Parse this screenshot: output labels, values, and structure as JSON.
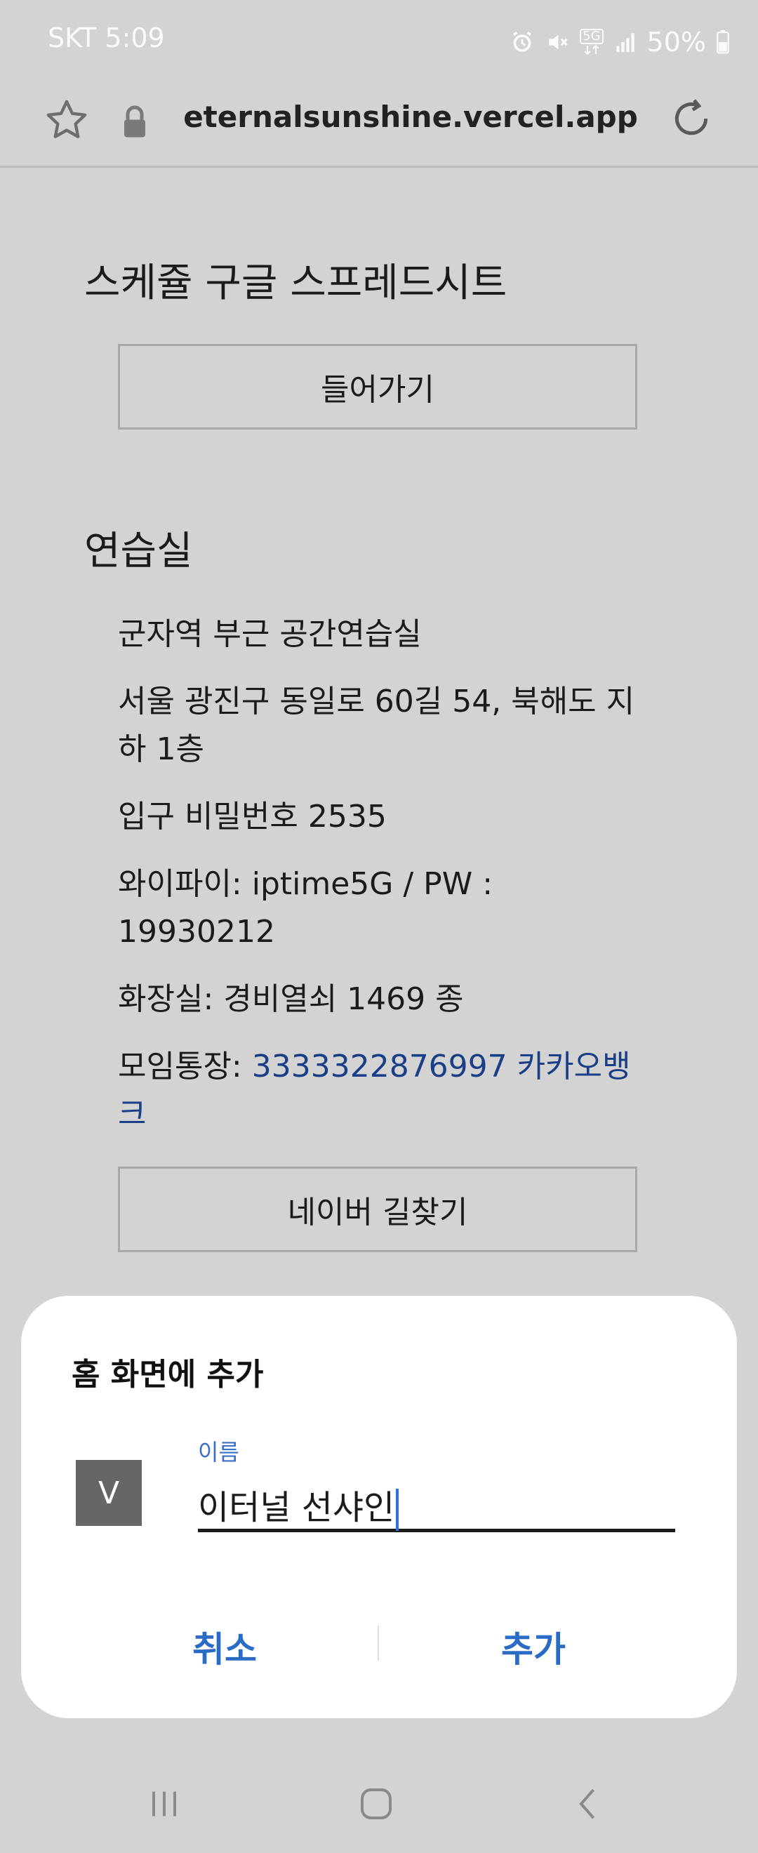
{
  "status_bar": {
    "carrier_time": "SKT 5:09",
    "network_badge": "5G",
    "battery": "50%",
    "icons": [
      "alarm-icon",
      "mute-icon",
      "5g-data-icon",
      "signal-icon",
      "battery-icon"
    ]
  },
  "browser": {
    "url": "eternalsunshine.vercel.app",
    "icons": [
      "star-icon",
      "lock-icon",
      "reload-icon"
    ]
  },
  "page": {
    "schedule_title": "스케쥴 구글 스프레드시트",
    "enter_button": "들어가기",
    "studio_title": "연습실",
    "studio_name": "군자역 부근 공간연습실",
    "address": "서울 광진구 동일로 60길 54, 북해도 지하 1층",
    "door_code": "입구 비밀번호 2535",
    "wifi": "와이파이: iptime5G / PW : 19930212",
    "restroom": "화장실: 경비열쇠 1469 종",
    "account_label": "모임통장: ",
    "account_link": "3333322876997 카카오뱅크",
    "naver_button": "네이버 길찾기"
  },
  "dialog": {
    "title": "홈 화면에 추가",
    "icon_letter": "V",
    "name_label": "이름",
    "name_value": "이터널 선샤인",
    "cancel": "취소",
    "add": "추가"
  },
  "nav": {
    "icons": [
      "recents-icon",
      "home-icon",
      "back-icon"
    ]
  },
  "colors": {
    "page_background": "#d3d3d3",
    "link": "#1a3f86",
    "dialog_button": "#2a6bc6",
    "input_label": "#3a6ec8",
    "caret": "#2e6fe0"
  }
}
